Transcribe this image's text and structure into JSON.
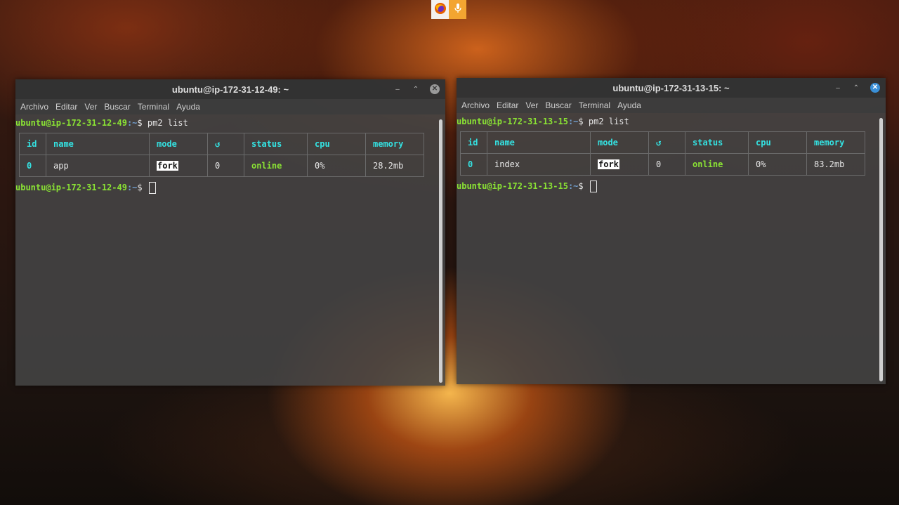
{
  "dock": {
    "items": [
      {
        "icon": "firefox-icon",
        "color": "#e66000"
      },
      {
        "icon": "microphone-icon",
        "color": "#f3a531"
      }
    ]
  },
  "terminals": [
    {
      "title": "ubuntu@ip-172-31-12-49: ~",
      "menu": [
        "Archivo",
        "Editar",
        "Ver",
        "Buscar",
        "Terminal",
        "Ayuda"
      ],
      "prompt_user": "ubuntu@ip-172-31-12-49",
      "prompt_path": ":~",
      "prompt_symbol": "$",
      "command": " pm2 list",
      "table": {
        "headers": [
          "id",
          "name",
          "mode",
          "↺",
          "status",
          "cpu",
          "memory"
        ],
        "row": {
          "id": "0",
          "name": "app",
          "mode": "fork",
          "restarts": "0",
          "status": "online",
          "cpu": "0%",
          "memory": "28.2mb"
        }
      }
    },
    {
      "title": "ubuntu@ip-172-31-13-15: ~",
      "menu": [
        "Archivo",
        "Editar",
        "Ver",
        "Buscar",
        "Terminal",
        "Ayuda"
      ],
      "prompt_user": "ubuntu@ip-172-31-13-15",
      "prompt_path": ":~",
      "prompt_symbol": "$",
      "command": " pm2 list",
      "table": {
        "headers": [
          "id",
          "name",
          "mode",
          "↺",
          "status",
          "cpu",
          "memory"
        ],
        "row": {
          "id": "0",
          "name": "index",
          "mode": "fork",
          "restarts": "0",
          "status": "online",
          "cpu": "0%",
          "memory": "83.2mb"
        }
      }
    }
  ],
  "controls": {
    "minimize": "–",
    "maximize": "⌃",
    "close": "✕"
  },
  "colors": {
    "prompt_user": "#8ae234",
    "table_header": "#34e2e2",
    "status_online": "#8ae234",
    "active_close": "#3a8fd6"
  }
}
